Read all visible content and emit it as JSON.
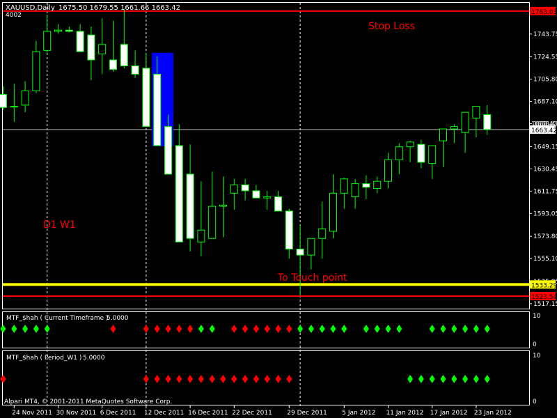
{
  "header": {
    "symbol": "XAUUSD,Daily",
    "ohlc": "1675.50 1679.55 1661.66 1663.42",
    "sub": "4002"
  },
  "footer": {
    "copyright": "Alpari MT4, © 2001-2011 MetaQuotes Software Corp."
  },
  "colors": {
    "background": "#000000",
    "bull_body": "#000000",
    "bear_body": "#ffffff",
    "candle_outline": "#00ff00",
    "stop_loss": "#ff0000",
    "touch_line": "#ffff00",
    "highlight": "#0000ff",
    "bid_line": "#c0c0c0",
    "diamond_up": "#00ff00",
    "diamond_down": "#ff0000"
  },
  "chart_data": [
    {
      "type": "candlestick",
      "symbol": "XAUUSD",
      "timeframe": "Daily",
      "x_tick_labels": [
        "24 Nov 2011",
        "30 Nov 2011",
        "6 Dec 2011",
        "12 Dec 2011",
        "16 Dec 2011",
        "22 Dec 2011",
        "29 Dec 2011",
        "5 Jan 2012",
        "11 Jan 2012",
        "17 Jan 2012",
        "23 Jan 2012"
      ],
      "y_tick_labels": [
        "1743.75",
        "1724.55",
        "1705.80",
        "1687.10",
        "1668.40",
        "1649.15",
        "1630.45",
        "1611.75",
        "1593.05",
        "1573.80",
        "1555.10",
        "1535.85",
        "1517.15"
      ],
      "ylim": [
        1513.0,
        1770.0
      ],
      "series": [
        {
          "x": [
            "23 Nov 2011",
            "24 Nov 2011",
            "25 Nov 2011",
            "28 Nov 2011",
            "29 Nov 2011",
            "30 Nov 2011",
            "1 Dec 2011",
            "2 Dec 2011",
            "5 Dec 2011",
            "6 Dec 2011",
            "7 Dec 2011",
            "8 Dec 2011",
            "9 Dec 2011",
            "12 Dec 2011",
            "13 Dec 2011",
            "14 Dec 2011",
            "15 Dec 2011",
            "16 Dec 2011",
            "19 Dec 2011",
            "20 Dec 2011",
            "21 Dec 2011",
            "22 Dec 2011",
            "23 Dec 2011",
            "26 Dec 2011",
            "27 Dec 2011",
            "28 Dec 2011",
            "29 Dec 2011",
            "30 Dec 2011",
            "2 Jan 2012",
            "3 Jan 2012",
            "4 Jan 2012",
            "5 Jan 2012",
            "6 Jan 2012",
            "9 Jan 2012",
            "10 Jan 2012",
            "11 Jan 2012",
            "12 Jan 2012",
            "13 Jan 2012",
            "16 Jan 2012",
            "17 Jan 2012",
            "18 Jan 2012",
            "19 Jan 2012",
            "20 Jan 2012",
            "23 Jan 2012",
            "24 Jan 2012"
          ],
          "open": [
            1693.0,
            1683.0,
            1684.0,
            1696.0,
            1730.0,
            1746.0,
            1747.0,
            1746.0,
            1743.0,
            1727.0,
            1722.0,
            1735.0,
            1717.0,
            1715.0,
            1710.0,
            1666.0,
            1650.0,
            1626.0,
            1569.0,
            1572.0,
            1599.0,
            1610.0,
            1617.0,
            1612.0,
            1606.0,
            1607.0,
            1595.0,
            1563.0,
            1558.0,
            1572.0,
            1578.0,
            1610.0,
            1607.0,
            1618.0,
            1614.0,
            1620.0,
            1638.0,
            1649.0,
            1651.0,
            1635.0,
            1654.0,
            1664.0,
            1661.0,
            1673.0,
            1676.0
          ],
          "high": [
            1700.0,
            1702.0,
            1704.0,
            1738.0,
            1760.0,
            1752.0,
            1750.0,
            1752.0,
            1750.0,
            1757.0,
            1755.0,
            1765.0,
            1730.0,
            1728.0,
            1725.0,
            1676.0,
            1668.0,
            1651.0,
            1620.0,
            1628.0,
            1624.0,
            1622.0,
            1622.0,
            1617.0,
            1612.0,
            1612.0,
            1597.0,
            1583.0,
            1572.0,
            1603.0,
            1626.0,
            1623.0,
            1622.0,
            1625.0,
            1624.0,
            1644.0,
            1652.0,
            1654.0,
            1655.0,
            1650.0,
            1664.0,
            1668.0,
            1670.0,
            1683.0,
            1684.0
          ],
          "low": [
            1680.0,
            1670.0,
            1678.0,
            1694.0,
            1727.0,
            1744.0,
            1745.0,
            1743.0,
            1705.0,
            1710.0,
            1712.0,
            1715.0,
            1707.0,
            1704.0,
            1666.0,
            1650.0,
            1626.0,
            1561.0,
            1557.0,
            1572.0,
            1573.0,
            1596.0,
            1604.0,
            1606.0,
            1596.0,
            1595.0,
            1555.0,
            1524.0,
            1546.0,
            1555.0,
            1572.0,
            1597.0,
            1597.0,
            1605.0,
            1610.0,
            1614.0,
            1626.0,
            1636.0,
            1631.0,
            1622.0,
            1632.0,
            1652.0,
            1644.0,
            1657.0,
            1659.0
          ],
          "close": [
            1682.0,
            1683.0,
            1696.0,
            1729.0,
            1746.0,
            1747.0,
            1746.0,
            1729.0,
            1722.0,
            1735.0,
            1714.0,
            1717.0,
            1710.0,
            1666.0,
            1650.0,
            1626.0,
            1569.0,
            1572.0,
            1579.0,
            1599.0,
            1600.0,
            1617.0,
            1612.0,
            1606.0,
            1607.0,
            1595.0,
            1563.0,
            1558.0,
            1572.0,
            1580.0,
            1610.0,
            1622.0,
            1618.0,
            1615.0,
            1620.0,
            1638.0,
            1649.0,
            1653.0,
            1636.0,
            1650.0,
            1664.0,
            1666.0,
            1678.0,
            1683.0,
            1663.42
          ]
        }
      ],
      "price_labels": {
        "stop_loss": "1763.03",
        "bid": "1663.42",
        "touch": "1533.29",
        "lower": "1523.54",
        "partial": "1668.40"
      },
      "levels": {
        "stop_loss": 1763.03,
        "bid": 1663.42,
        "touch": 1533.29,
        "lower": 1523.54
      },
      "highlight_box": {
        "from": "13 Dec 2011",
        "to": "14 Dec 2011",
        "price_low": 1649.5,
        "price_high": 1728.0
      },
      "vertical_separators": [
        "29 Nov 2011",
        "12 Dec 2011",
        "30 Dec 2011"
      ],
      "annotations": [
        "Stop Loss",
        "D1 W1",
        "To Touch point"
      ]
    },
    {
      "type": "scatter",
      "title": "MTF_$hah ( Current Timeframe )",
      "value": "5.0000",
      "axis_labels": [
        "10",
        "0"
      ],
      "up_dates": [
        "23 Nov 2011",
        "24 Nov 2011",
        "25 Nov 2011",
        "28 Nov 2011",
        "29 Nov 2011",
        "19 Dec 2011",
        "20 Dec 2011",
        "30 Dec 2011",
        "2 Jan 2012",
        "3 Jan 2012",
        "4 Jan 2012",
        "5 Jan 2012",
        "9 Jan 2012",
        "10 Jan 2012",
        "11 Jan 2012",
        "12 Jan 2012",
        "17 Jan 2012",
        "18 Jan 2012",
        "19 Jan 2012",
        "20 Jan 2012",
        "23 Jan 2012",
        "24 Jan 2012"
      ],
      "down_dates": [
        "7 Dec 2011",
        "12 Dec 2011",
        "13 Dec 2011",
        "14 Dec 2011",
        "15 Dec 2011",
        "16 Dec 2011",
        "22 Dec 2011",
        "23 Dec 2011",
        "26 Dec 2011",
        "27 Dec 2011",
        "28 Dec 2011",
        "29 Dec 2011"
      ]
    },
    {
      "type": "scatter",
      "title": "MTF_$hah ( Period_W1 )",
      "value": "5.0000",
      "axis_labels": [
        "10",
        "0"
      ],
      "up_dates": [
        "13 Jan 2012",
        "16 Jan 2012",
        "17 Jan 2012",
        "18 Jan 2012",
        "19 Jan 2012",
        "20 Jan 2012",
        "23 Jan 2012",
        "24 Jan 2012"
      ],
      "down_dates": [
        "23 Nov 2011",
        "12 Dec 2011",
        "13 Dec 2011",
        "14 Dec 2011",
        "15 Dec 2011",
        "16 Dec 2011",
        "19 Dec 2011",
        "20 Dec 2011",
        "21 Dec 2011",
        "22 Dec 2011",
        "23 Dec 2011",
        "26 Dec 2011",
        "27 Dec 2011",
        "28 Dec 2011",
        "29 Dec 2011"
      ]
    }
  ]
}
